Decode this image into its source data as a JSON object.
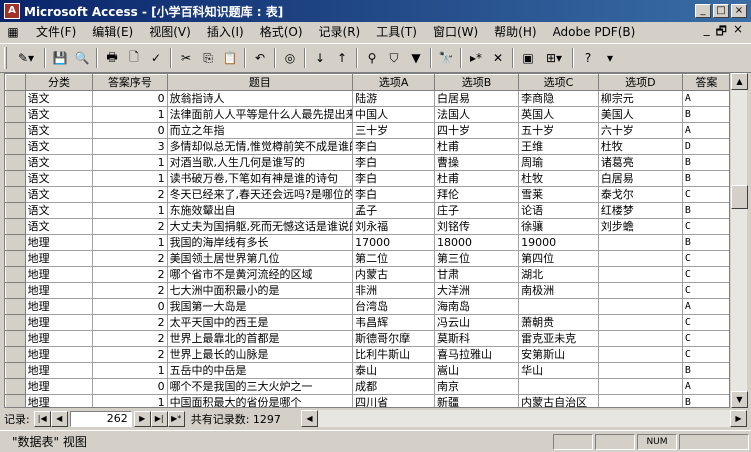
{
  "window": {
    "title": "Microsoft Access - [小学百科知识题库 : 表]",
    "app_icon": "A"
  },
  "menu": [
    {
      "label": "文件(F)"
    },
    {
      "label": "编辑(E)"
    },
    {
      "label": "视图(V)"
    },
    {
      "label": "插入(I)"
    },
    {
      "label": "格式(O)"
    },
    {
      "label": "记录(R)"
    },
    {
      "label": "工具(T)"
    },
    {
      "label": "窗口(W)"
    },
    {
      "label": "帮助(H)"
    },
    {
      "label": "Adobe PDF(B)"
    }
  ],
  "table": {
    "columns": [
      "分类",
      "答案序号",
      "题目",
      "选项A",
      "选项B",
      "选项C",
      "选项D",
      "答案"
    ],
    "rows": [
      [
        "语文",
        "0",
        "放翁指诗人",
        "陆游",
        "白居易",
        "李商隐",
        "柳宗元",
        "A"
      ],
      [
        "语文",
        "1",
        "法律面前人人平等是什么人最先提出来的",
        "中国人",
        "法国人",
        "英国人",
        "美国人",
        "B"
      ],
      [
        "语文",
        "0",
        "而立之年指",
        "三十岁",
        "四十岁",
        "五十岁",
        "六十岁",
        "A"
      ],
      [
        "语文",
        "3",
        "多情却似总无情,惟觉樽前笑不成是谁的诗",
        "李白",
        "杜甫",
        "王维",
        "杜牧",
        "D"
      ],
      [
        "语文",
        "1",
        "对酒当歌,人生几何是谁写的",
        "李白",
        "曹操",
        "周瑜",
        "诸葛亮",
        "B"
      ],
      [
        "语文",
        "1",
        "读书破万卷,下笔如有神是谁的诗句",
        "李白",
        "杜甫",
        "杜牧",
        "白居易",
        "B"
      ],
      [
        "语文",
        "2",
        "冬天已经来了,春天还会远吗?是哪位的名",
        "李白",
        "拜伦",
        "雪莱",
        "泰戈尔",
        "C"
      ],
      [
        "语文",
        "1",
        "东施效颦出自",
        "孟子",
        "庄子",
        "论语",
        "红楼梦",
        "B"
      ],
      [
        "语文",
        "2",
        "大丈夫为国捐躯,死而无憾这话是谁说的",
        "刘永福",
        "刘铭传",
        "徐骧",
        "刘步蟾",
        "C"
      ],
      [
        "地理",
        "1",
        "我国的海岸线有多长",
        "17000",
        "18000",
        "19000",
        "",
        "B"
      ],
      [
        "地理",
        "2",
        "美国领土居世界第几位",
        "第二位",
        "第三位",
        "第四位",
        "",
        "C"
      ],
      [
        "地理",
        "2",
        "哪个省市不是黄河流经的区域",
        "内蒙古",
        "甘肃",
        "湖北",
        "",
        "C"
      ],
      [
        "地理",
        "2",
        "七大洲中面积最小的是",
        "非洲",
        "大洋洲",
        "南极洲",
        "",
        "C"
      ],
      [
        "地理",
        "0",
        "我国第一大岛是",
        "台湾岛",
        "海南岛",
        "",
        "",
        "A"
      ],
      [
        "地理",
        "2",
        "太平天国中的西王是",
        "韦昌辉",
        "冯云山",
        "萧朝贵",
        "",
        "C"
      ],
      [
        "地理",
        "2",
        "世界上最靠北的首都是",
        "斯德哥尔摩",
        "莫斯科",
        "雷克亚未克",
        "",
        "C"
      ],
      [
        "地理",
        "2",
        "世界上最长的山脉是",
        "比利牛斯山",
        "喜马拉雅山",
        "安第斯山",
        "",
        "C"
      ],
      [
        "地理",
        "1",
        "五岳中的中岳是",
        "泰山",
        "嵩山",
        "华山",
        "",
        "B"
      ],
      [
        "地理",
        "0",
        "哪个不是我国的三大火炉之一",
        "成都",
        "南京",
        "",
        "",
        "A"
      ],
      [
        "地理",
        "1",
        "中国面积最大的省份是哪个",
        "四川省",
        "新疆",
        "内蒙古自治区",
        "",
        "B"
      ]
    ]
  },
  "navigation": {
    "label": "记录:",
    "current_record": "262",
    "count_text": "共有记录数: 1297"
  },
  "status": {
    "view_text": "\"数据表\" 视图",
    "num_indicator": "NUM"
  }
}
